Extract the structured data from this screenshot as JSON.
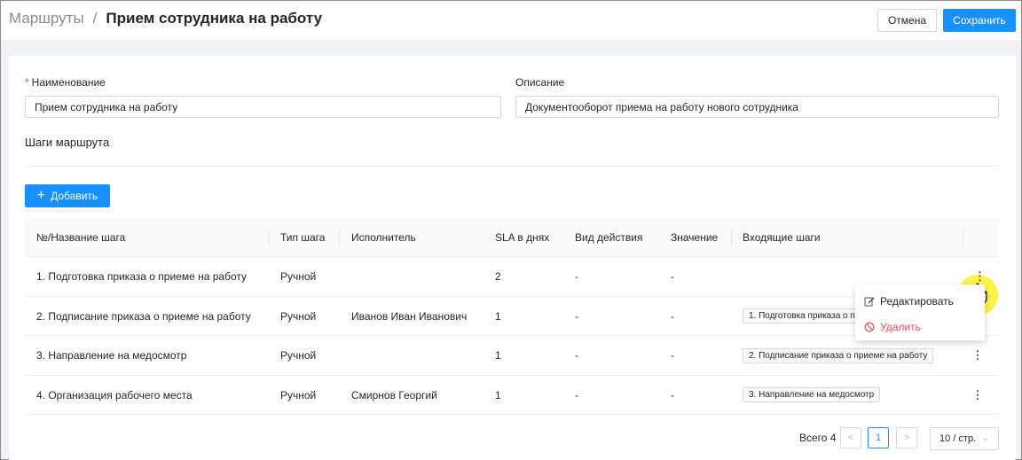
{
  "header": {
    "breadcrumb_root": "Маршруты",
    "breadcrumb_sep": "/",
    "title": "Прием сотрудника на работу",
    "cancel_label": "Отмена",
    "save_label": "Сохранить"
  },
  "form": {
    "name_label": "Наименование",
    "name_required_mark": "*",
    "name_value": "Прием сотрудника на работу",
    "description_label": "Описание",
    "description_value": "Документооборот приема на работу нового сотрудника",
    "steps_title": "Шаги маршрута",
    "add_label": "Добавить"
  },
  "table": {
    "columns": [
      "№/Название шага",
      "Тип шага",
      "Исполнитель",
      "SLA в днях",
      "Вид действия",
      "Значение",
      "Входящие шаги"
    ],
    "rows": [
      {
        "name": "1. Подготовка приказа о приеме на работу",
        "type": "Ручной",
        "executor": "",
        "sla": "2",
        "action": "-",
        "value": "-",
        "incoming": ""
      },
      {
        "name": "2. Подписание приказа о приеме на работу",
        "type": "Ручной",
        "executor": "Иванов Иван Иванович",
        "sla": "1",
        "action": "-",
        "value": "-",
        "incoming": "1. Подготовка приказа о п"
      },
      {
        "name": "3. Направление на медосмотр",
        "type": "Ручной",
        "executor": "",
        "sla": "1",
        "action": "-",
        "value": "-",
        "incoming": "2. Подписание приказа о приеме на работу"
      },
      {
        "name": "4. Организация рабочего места",
        "type": "Ручной",
        "executor": "Смирнов Георгий",
        "sla": "1",
        "action": "-",
        "value": "-",
        "incoming": "3. Направление на медосмотр"
      }
    ]
  },
  "context_menu": {
    "edit_label": "Редактировать",
    "delete_label": "Удалить"
  },
  "pagination": {
    "total_label": "Всего 4",
    "prev": "<",
    "current_page": "1",
    "next": ">",
    "page_size": "10 / стр."
  },
  "colors": {
    "primary": "#1890ff",
    "danger": "#ff4d4f",
    "cursor_highlight": "#fff028"
  }
}
